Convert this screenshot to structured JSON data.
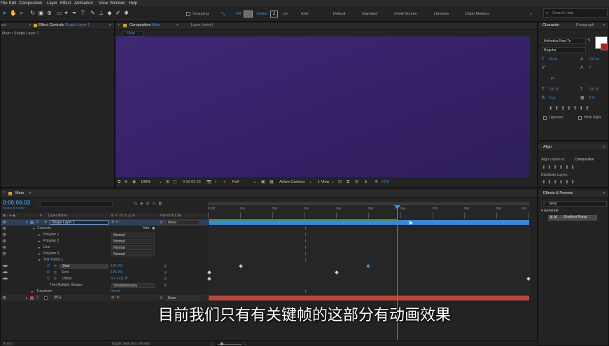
{
  "menu": [
    "File",
    "Edit",
    "Composition",
    "Layer",
    "Effect",
    "Animation",
    "View",
    "Window",
    "Help"
  ],
  "toolbar": {
    "snapping": "Snapping",
    "fill": "Fill",
    "stroke": "Stroke",
    "stroke_width": "2",
    "px": "- px",
    "add": "Add:",
    "workspaces": [
      "Default",
      "Standard",
      "Small Screen",
      "Libraries",
      "Dope Motions"
    ],
    "search": "Search Help"
  },
  "left_panel": {
    "tab_project": "ect",
    "tab_effect_controls": "Effect Controls",
    "tab_layer": "Shape Layer 1",
    "breadcrumb": "Main • Shape Layer 1"
  },
  "comp_panel": {
    "tab": "Composition",
    "tab_name": "Main",
    "layer_tab": "Layer (none)",
    "subtab": "Main",
    "zoom": "100%",
    "timecode": "0:00:05:26",
    "resolution": "Full",
    "camera": "Active Camera",
    "views": "1 View",
    "exposure": "+0.0"
  },
  "character": {
    "tab": "Character",
    "tab2": "Paragraph",
    "font": "Helvetica Now Te",
    "style": "Regular",
    "size": "40 px",
    "leading": "104 px",
    "tracking": "0",
    "stroke": "- px",
    "vscale": "100 %",
    "hscale": "100 %",
    "baseline": "0 px",
    "tsume": "0 %",
    "ligatures": "Ligatures",
    "hindi": "Hindi Digits"
  },
  "align": {
    "tab": "Align",
    "align_to_label": "Align Layers to:",
    "align_to": "Composition",
    "distribute": "Distribute Layers:"
  },
  "effects": {
    "tab": "Effects & Presets",
    "search": "ramp",
    "category": "Generate",
    "item": "Gradient Ramp"
  },
  "timeline": {
    "tab": "Main",
    "timecode": "0:00:06:03",
    "fps": "00183 (30.00 fps)",
    "col_layer_name": "Layer Name",
    "col_parent": "Parent & Link",
    "ruler": [
      "0:00f",
      "01s",
      "02s",
      "03s",
      "04s",
      "05s",
      "06s",
      "07s",
      "08s",
      "09s",
      "10s"
    ],
    "toggle": "Toggle Switches / Modes",
    "layers": [
      {
        "num": "1",
        "name": "Shape Layer 1",
        "parent": "None",
        "color": "#3b86d8"
      },
      {
        "num": "2",
        "name": "[BG]",
        "parent": "None",
        "color": "#c4463d"
      }
    ],
    "contents": "Contents",
    "add": "Add:",
    "groups": [
      {
        "name": "Polystar 1",
        "mode": "Normal"
      },
      {
        "name": "Polystar 2",
        "mode": "Normal"
      },
      {
        "name": "Line",
        "mode": "Normal"
      },
      {
        "name": "Polystar 3",
        "mode": "Normal"
      }
    ],
    "trim": "Trim Paths 1",
    "start": {
      "label": "Start",
      "value": "100.0%"
    },
    "end": {
      "label": "End",
      "value": "100.0%"
    },
    "offset": {
      "label": "Offset",
      "value": "0 x +211.9°"
    },
    "trim_multiple": "Trim Multiple Shapes",
    "trim_multiple_value": "Simultaneously",
    "transform": "Transform",
    "reset": "Reset",
    "layer1_mode": "None"
  },
  "subtitle": "目前我们只有有关键帧的这部分有动画效果"
}
